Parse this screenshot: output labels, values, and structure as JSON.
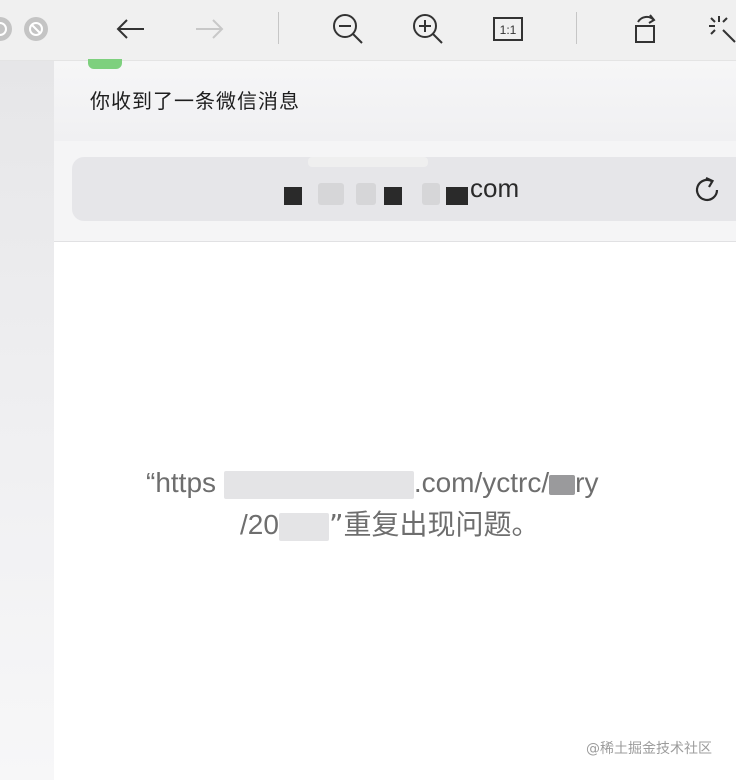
{
  "toolbar": {
    "buttons": [
      {
        "name": "back-icon"
      },
      {
        "name": "forward-icon"
      },
      {
        "name": "zoom-out-icon"
      },
      {
        "name": "zoom-in-icon"
      },
      {
        "name": "actual-size-icon"
      },
      {
        "name": "rotate-icon"
      },
      {
        "name": "magic-wand-icon"
      }
    ],
    "actual_size_label": "1:1"
  },
  "notification": {
    "text": "你收到了一条微信消息"
  },
  "address_bar": {
    "url_visible": "com"
  },
  "message": {
    "line1_prefix": "“https",
    "line1_middle": ".com/yctrc/",
    "line1_suffix": "ry",
    "line2_prefix": "/20",
    "line2_suffix": "”重复出现问题。"
  },
  "watermark": "@稀土掘金技术社区",
  "colors": {
    "toolbar_bg": "#f0f0f0",
    "urlbar_bg": "#e6e6e9",
    "message_text": "#6e6e6e",
    "notification_green": "#7ed07e"
  }
}
